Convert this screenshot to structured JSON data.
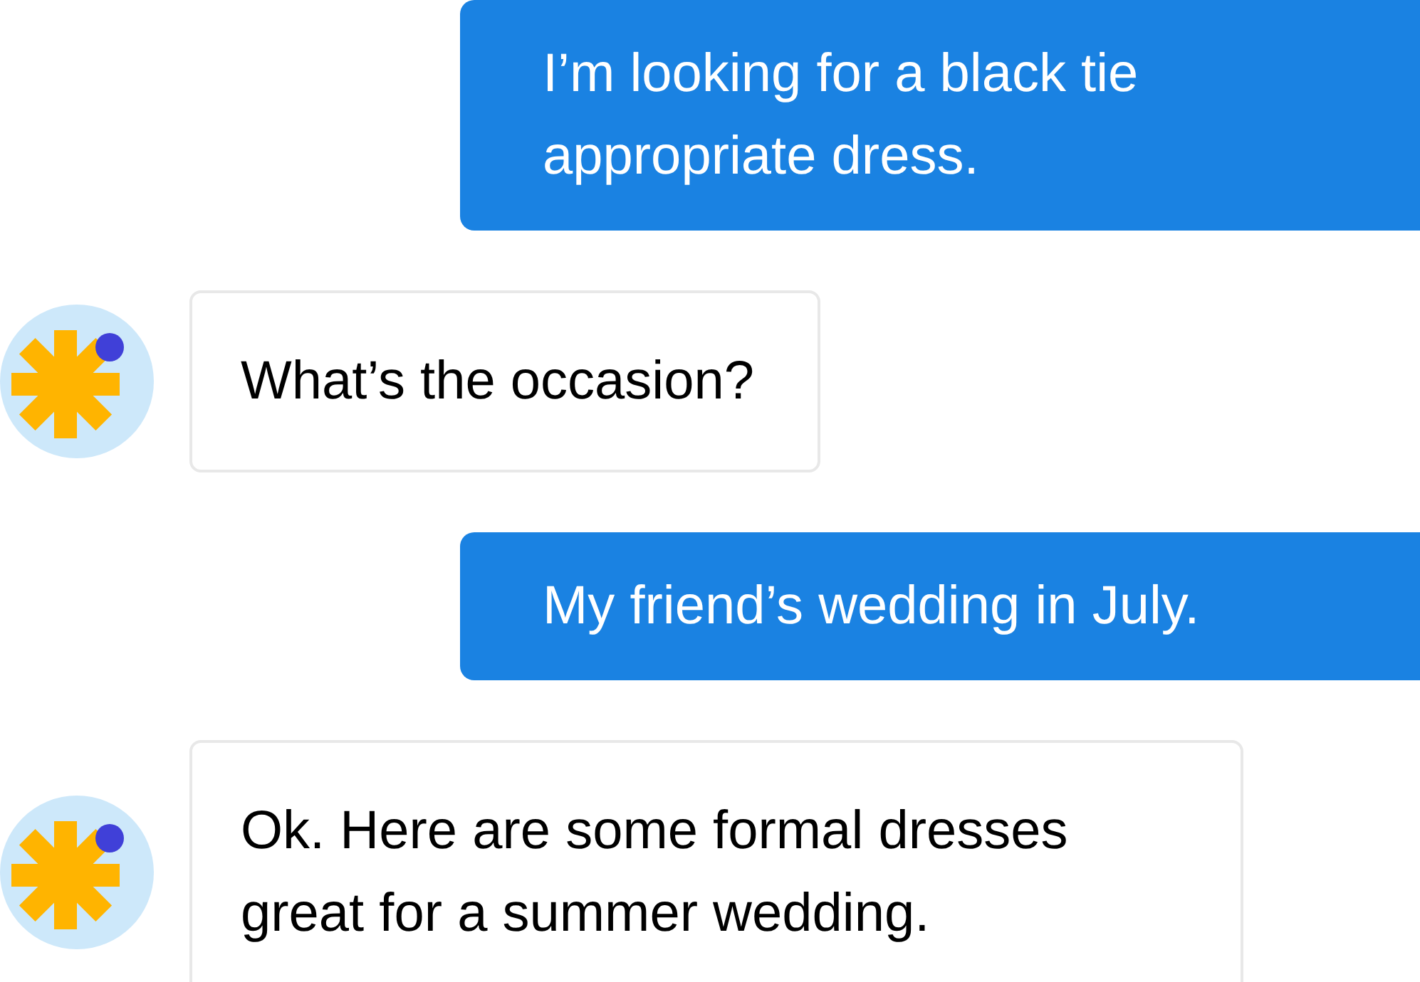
{
  "messages": [
    {
      "kind": "user",
      "text": "I’m looking for a black tie appropriate dress."
    },
    {
      "kind": "bot",
      "text": "What’s the occasion?"
    },
    {
      "kind": "user",
      "text": "My friend’s wedding in July."
    },
    {
      "kind": "bot",
      "text": "Ok. Here are some formal dresses great for a summer wedding."
    }
  ]
}
